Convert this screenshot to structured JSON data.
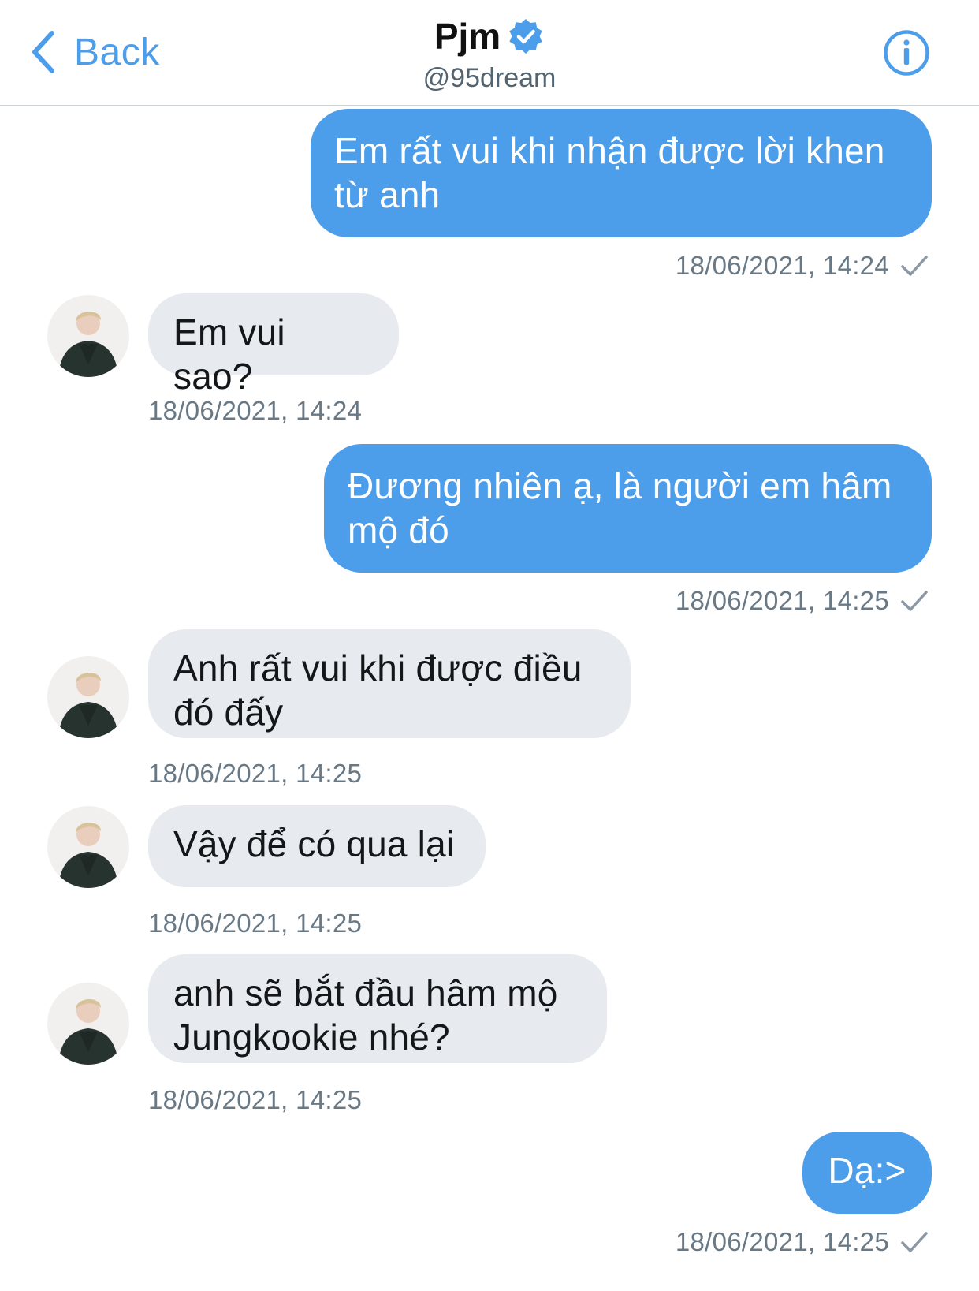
{
  "header": {
    "back_label": "Back",
    "name": "Pjm",
    "handle": "@95dream"
  },
  "colors": {
    "accent": "#4c9eea",
    "incoming_bubble": "#e7eaee",
    "timestamp": "#687884"
  },
  "icons": {
    "back": "chevron-left-icon",
    "verified": "verified-badge-icon",
    "info": "info-icon",
    "read": "checkmark-icon"
  },
  "messages": [
    {
      "direction": "out",
      "text": "Em rất vui khi nhận được lời khen từ anh",
      "time": "18/06/2021, 14:24"
    },
    {
      "direction": "in",
      "text": "Em vui sao?",
      "time": "18/06/2021, 14:24"
    },
    {
      "direction": "out",
      "text": "Đương nhiên ạ, là người em hâm mộ đó",
      "time": "18/06/2021, 14:25"
    },
    {
      "direction": "in",
      "text": "Anh rất vui khi được điều đó đấy",
      "time": "18/06/2021, 14:25"
    },
    {
      "direction": "in",
      "text": "Vậy để có qua lại",
      "time": "18/06/2021, 14:25"
    },
    {
      "direction": "in",
      "text": "anh sẽ bắt đầu hâm mộ Jungkookie nhé?",
      "time": "18/06/2021, 14:25"
    },
    {
      "direction": "out",
      "text": "Dạ:>",
      "time": "18/06/2021, 14:25"
    }
  ]
}
